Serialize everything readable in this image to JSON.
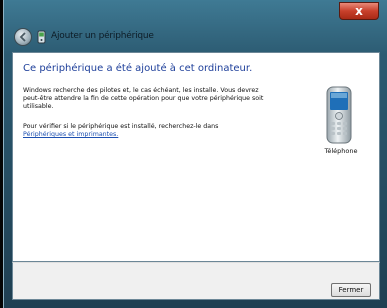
{
  "window": {
    "title": "Ajouter un périphérique",
    "close_label": "x"
  },
  "content": {
    "heading": "Ce périphérique a été ajouté à cet ordinateur.",
    "paragraph1": "Windows recherche des pilotes et, le cas échéant, les installe. Vous devrez peut-être attendre la fin de cette opération pour que votre périphérique soit utilisable.",
    "paragraph2": "Pour vérifier si le périphérique est installé, recherchez-le dans",
    "link": "Périphériques et imprimantes."
  },
  "device": {
    "label": "Téléphone",
    "icon": "phone-icon"
  },
  "footer": {
    "ok_label": "Fermer"
  },
  "colors": {
    "heading": "#1e3f9a",
    "link": "#1c4fb0",
    "close": "#c8402b"
  }
}
